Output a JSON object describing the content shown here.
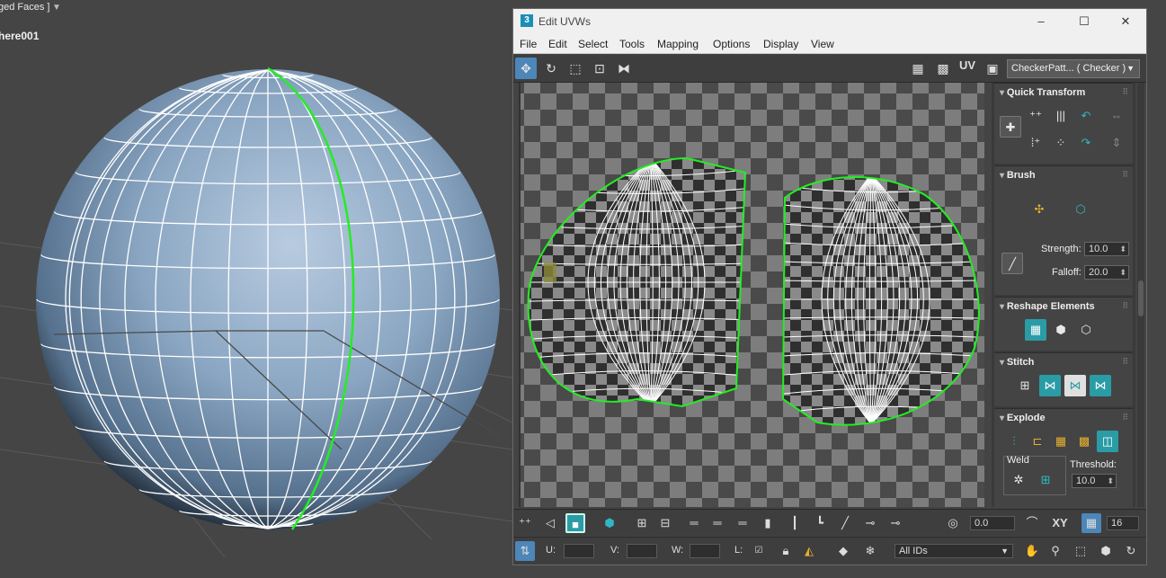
{
  "viewport": {
    "label": "ged Faces ]",
    "object_name": "here001",
    "filter_icon": "filter-icon"
  },
  "window": {
    "title": "Edit UVWs",
    "controls": {
      "minimize": "–",
      "maximize": "☐",
      "close": "✕"
    }
  },
  "menu": {
    "items": [
      "File",
      "Edit",
      "Select",
      "Tools",
      "Mapping",
      "Options",
      "Display",
      "View"
    ]
  },
  "toolbar": {
    "uv_label": "UV",
    "texture_dropdown": "CheckerPatt... ( Checker )"
  },
  "quick_transform": {
    "title": "Quick Transform"
  },
  "brush": {
    "title": "Brush",
    "strength_label": "Strength:",
    "strength_value": "10.0",
    "falloff_label": "Falloff:",
    "falloff_value": "20.0"
  },
  "reshape": {
    "title": "Reshape Elements"
  },
  "stitch": {
    "title": "Stitch"
  },
  "explode": {
    "title": "Explode",
    "weld_label": "Weld",
    "threshold_label": "Threshold:",
    "threshold_value": "10.0"
  },
  "bottom1": {
    "rotate_value": "0.0",
    "axis_label": "XY",
    "grid_value": "16"
  },
  "bottom2": {
    "u_label": "U:",
    "v_label": "V:",
    "w_label": "W:",
    "l_label": "L:",
    "ids_value": "All IDs"
  },
  "colors": {
    "accent_teal": "#2a9ca6",
    "seam_green": "#22ee22",
    "sphere_blue": "#8aa6c2",
    "active_blue": "#4d86b8"
  }
}
